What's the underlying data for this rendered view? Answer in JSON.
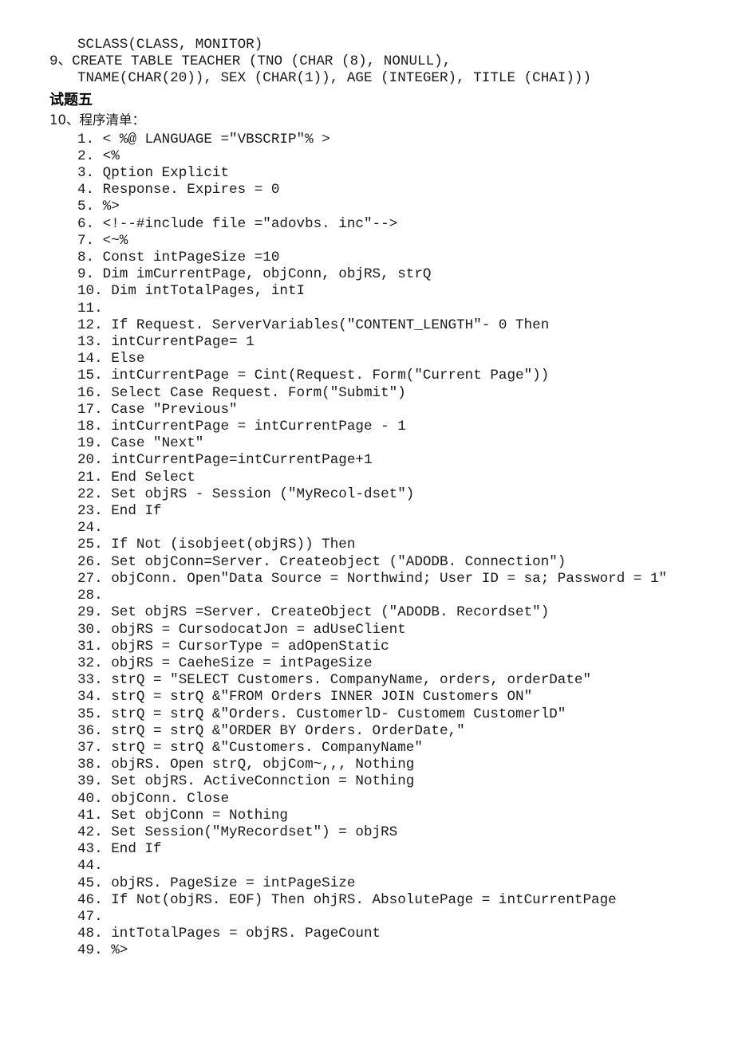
{
  "document": {
    "intro_lines": [
      {
        "text": "SCLASS(CLASS, MONITOR)",
        "indent": "indent"
      },
      {
        "text": "9、CREATE TABLE TEACHER (TNO (CHAR (8), NONULL),",
        "indent": "flush"
      },
      {
        "text": "TNAME(CHAR(20)), SEX (CHAR(1)), AGE (INTEGER), TITLE (CHAI)))",
        "indent": "indent"
      }
    ],
    "section_heading": "试题五",
    "section_subtitle": "10、程序清单：",
    "code_lines": [
      "1. < %@ LANGUAGE =\"VBSCRIP\"% >",
      "2. <%",
      "3. Qption Explicit",
      "4. Response. Expires = 0",
      "5. %>",
      "6. <!--#include file =\"adovbs. inc\"-->",
      "7. <~%",
      "8. Const intPageSize =10",
      "9. Dim imCurrentPage, objConn, objRS, strQ",
      "10. Dim intTotalPages, intI",
      "11.",
      "12. If Request. ServerVariables(\"CONTENT_LENGTH\"- 0 Then",
      "13. intCurrentPage= 1",
      "14. Else",
      "15. intCurrentPage = Cint(Request. Form(\"Current Page\"))",
      "16. Select Case Request. Form(\"Submit\")",
      "17. Case \"Previous\"",
      "18. intCurrentPage = intCurrentPage - 1",
      "19. Case \"Next\"",
      "20. intCurrentPage=intCurrentPage+1",
      "21. End Select",
      "22. Set objRS - Session (\"MyRecol-dset\")",
      "23. End If",
      "24.",
      "25. If Not (isobjeet(objRS)) Then",
      "26. Set objConn=Server. Createobject (\"ADODB. Connection\")",
      "27. objConn. Open\"Data Source = Northwind; User ID = sa; Password = 1\"",
      "28.",
      "29. Set objRS =Server. CreateObject (\"ADODB. Recordset\")",
      "30. objRS = CursodocatJon = adUseClient",
      "31. objRS = CursorType = adOpenStatic",
      "32. objRS = CaeheSize = intPageSize",
      "33. strQ = \"SELECT Customers. CompanyName, orders, orderDate\"",
      "34. strQ = strQ &\"FROM Orders INNER JOIN Customers ON\"",
      "35. strQ = strQ &\"Orders. CustomerlD- Customem CustomerlD\"",
      "36. strQ = strQ &\"ORDER BY Orders. OrderDate,\"",
      "37. strQ = strQ &\"Customers. CompanyName\"",
      "38. objRS. Open strQ, objCom~,,, Nothing",
      "39. Set objRS. ActiveConnction = Nothing",
      "40. objConn. Close",
      "41. Set objConn = Nothing",
      "42. Set Session(\"MyRecordset\") = objRS",
      "43. End If",
      "44.",
      "45. objRS. PageSize = intPageSize",
      "46. If Not(objRS. EOF) Then ohjRS. AbsolutePage = intCurrentPage",
      "47.",
      "48. intTotalPages = objRS. PageCount",
      "49. %>"
    ]
  }
}
